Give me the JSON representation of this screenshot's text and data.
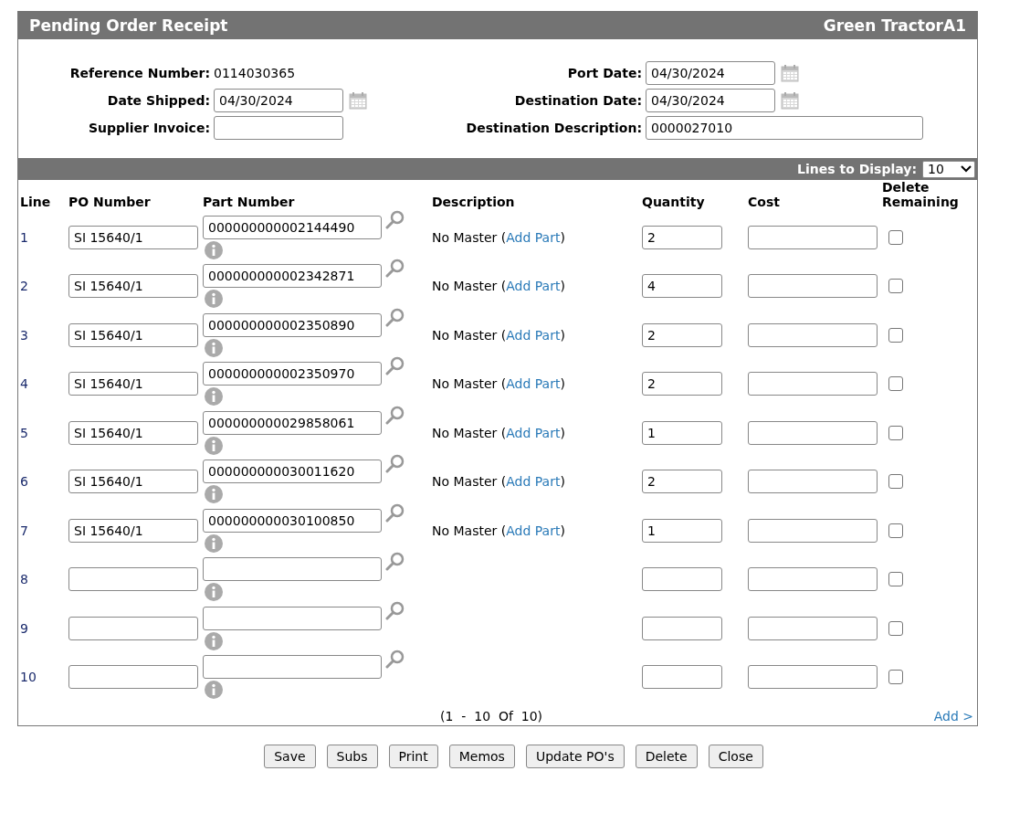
{
  "header": {
    "title": "Pending Order Receipt",
    "company": "Green TractorA1"
  },
  "form": {
    "reference_number": {
      "label": "Reference Number:",
      "value": "0114030365"
    },
    "port_date": {
      "label": "Port Date:",
      "value": "04/30/2024"
    },
    "date_shipped": {
      "label": "Date Shipped:",
      "value": "04/30/2024"
    },
    "destination_date": {
      "label": "Destination Date:",
      "value": "04/30/2024"
    },
    "supplier_invoice": {
      "label": "Supplier Invoice:"
    },
    "destination_description": {
      "label": "Destination Description:",
      "value": "0000027010"
    }
  },
  "lines_to_display": {
    "label": "Lines to Display:",
    "value": "10"
  },
  "table": {
    "columns": [
      "Line",
      "PO Number",
      "Part Number",
      "Description",
      "Quantity",
      "Cost",
      "Delete Remaining"
    ],
    "rows": [
      {
        "line": "1",
        "po_number": "SI 15640/1",
        "part_number": "000000000002144490",
        "description": {
          "prefix": "No Master (",
          "link": "Add Part",
          "suffix": ")"
        },
        "quantity": "2",
        "delete_remaining": false
      },
      {
        "line": "2",
        "po_number": "SI 15640/1",
        "part_number": "000000000002342871",
        "description": {
          "prefix": "No Master (",
          "link": "Add Part",
          "suffix": ")"
        },
        "quantity": "4",
        "delete_remaining": false
      },
      {
        "line": "3",
        "po_number": "SI 15640/1",
        "part_number": "000000000002350890",
        "description": {
          "prefix": "No Master (",
          "link": "Add Part",
          "suffix": ")"
        },
        "quantity": "2",
        "delete_remaining": false
      },
      {
        "line": "4",
        "po_number": "SI 15640/1",
        "part_number": "000000000002350970",
        "description": {
          "prefix": "No Master (",
          "link": "Add Part",
          "suffix": ")"
        },
        "quantity": "2",
        "delete_remaining": false
      },
      {
        "line": "5",
        "po_number": "SI 15640/1",
        "part_number": "000000000029858061",
        "description": {
          "prefix": "No Master (",
          "link": "Add Part",
          "suffix": ")"
        },
        "quantity": "1",
        "delete_remaining": false
      },
      {
        "line": "6",
        "po_number": "SI 15640/1",
        "part_number": "000000000030011620",
        "description": {
          "prefix": "No Master (",
          "link": "Add Part",
          "suffix": ")"
        },
        "quantity": "2",
        "delete_remaining": false
      },
      {
        "line": "7",
        "po_number": "SI 15640/1",
        "part_number": "000000000030100850",
        "description": {
          "prefix": "No Master (",
          "link": "Add Part",
          "suffix": ")"
        },
        "quantity": "1",
        "delete_remaining": false
      },
      {
        "line": "8",
        "delete_remaining": false
      },
      {
        "line": "9",
        "delete_remaining": false
      },
      {
        "line": "10",
        "delete_remaining": false
      }
    ]
  },
  "pagination": {
    "range": "(1  -  10  Of  10)",
    "add_link": "Add >"
  },
  "buttons": [
    "Save",
    "Subs",
    "Print",
    "Memos",
    "Update PO's",
    "Delete",
    "Close"
  ]
}
